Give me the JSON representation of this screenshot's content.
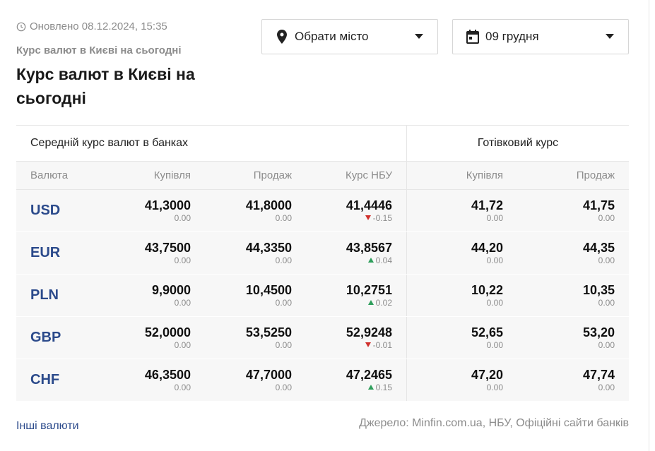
{
  "updated": "Оновлено 08.12.2024, 15:35",
  "subtitle": "Курс валют в Києві на сьогодні",
  "title": "Курс валют в Києві на сьогодні",
  "city_select": {
    "label": "Обрати місто"
  },
  "date_select": {
    "label": "09 грудня"
  },
  "table": {
    "group_bank": "Середній курс валют в банках",
    "group_cash": "Готівковий курс",
    "columns": [
      "Валюта",
      "Купівля",
      "Продаж",
      "Курс НБУ",
      "Купівля",
      "Продаж"
    ],
    "rows": [
      {
        "cur": "USD",
        "buy": "41,3000",
        "buy_chg": "0.00",
        "sell": "41,8000",
        "sell_chg": "0.00",
        "nbu": "41,4446",
        "nbu_chg": "-0.15",
        "nbu_dir": "down",
        "cbuy": "41,72",
        "cbuy_chg": "0.00",
        "csell": "41,75",
        "csell_chg": "0.00"
      },
      {
        "cur": "EUR",
        "buy": "43,7500",
        "buy_chg": "0.00",
        "sell": "44,3350",
        "sell_chg": "0.00",
        "nbu": "43,8567",
        "nbu_chg": "0.04",
        "nbu_dir": "up",
        "cbuy": "44,20",
        "cbuy_chg": "0.00",
        "csell": "44,35",
        "csell_chg": "0.00"
      },
      {
        "cur": "PLN",
        "buy": "9,9000",
        "buy_chg": "0.00",
        "sell": "10,4500",
        "sell_chg": "0.00",
        "nbu": "10,2751",
        "nbu_chg": "0.02",
        "nbu_dir": "up",
        "cbuy": "10,22",
        "cbuy_chg": "0.00",
        "csell": "10,35",
        "csell_chg": "0.00"
      },
      {
        "cur": "GBP",
        "buy": "52,0000",
        "buy_chg": "0.00",
        "sell": "53,5250",
        "sell_chg": "0.00",
        "nbu": "52,9248",
        "nbu_chg": "-0.01",
        "nbu_dir": "down",
        "cbuy": "52,65",
        "cbuy_chg": "0.00",
        "csell": "53,20",
        "csell_chg": "0.00"
      },
      {
        "cur": "CHF",
        "buy": "46,3500",
        "buy_chg": "0.00",
        "sell": "47,7000",
        "sell_chg": "0.00",
        "nbu": "47,2465",
        "nbu_chg": "0.15",
        "nbu_dir": "up",
        "cbuy": "47,20",
        "cbuy_chg": "0.00",
        "csell": "47,74",
        "csell_chg": "0.00"
      }
    ]
  },
  "other_link": "Інші валюти",
  "source": "Джерело: Minfin.com.ua, НБУ, Офіційні сайти банків",
  "colors": {
    "accent": "#2b4a8b",
    "up": "#2e9e5b",
    "down": "#d0312d"
  }
}
